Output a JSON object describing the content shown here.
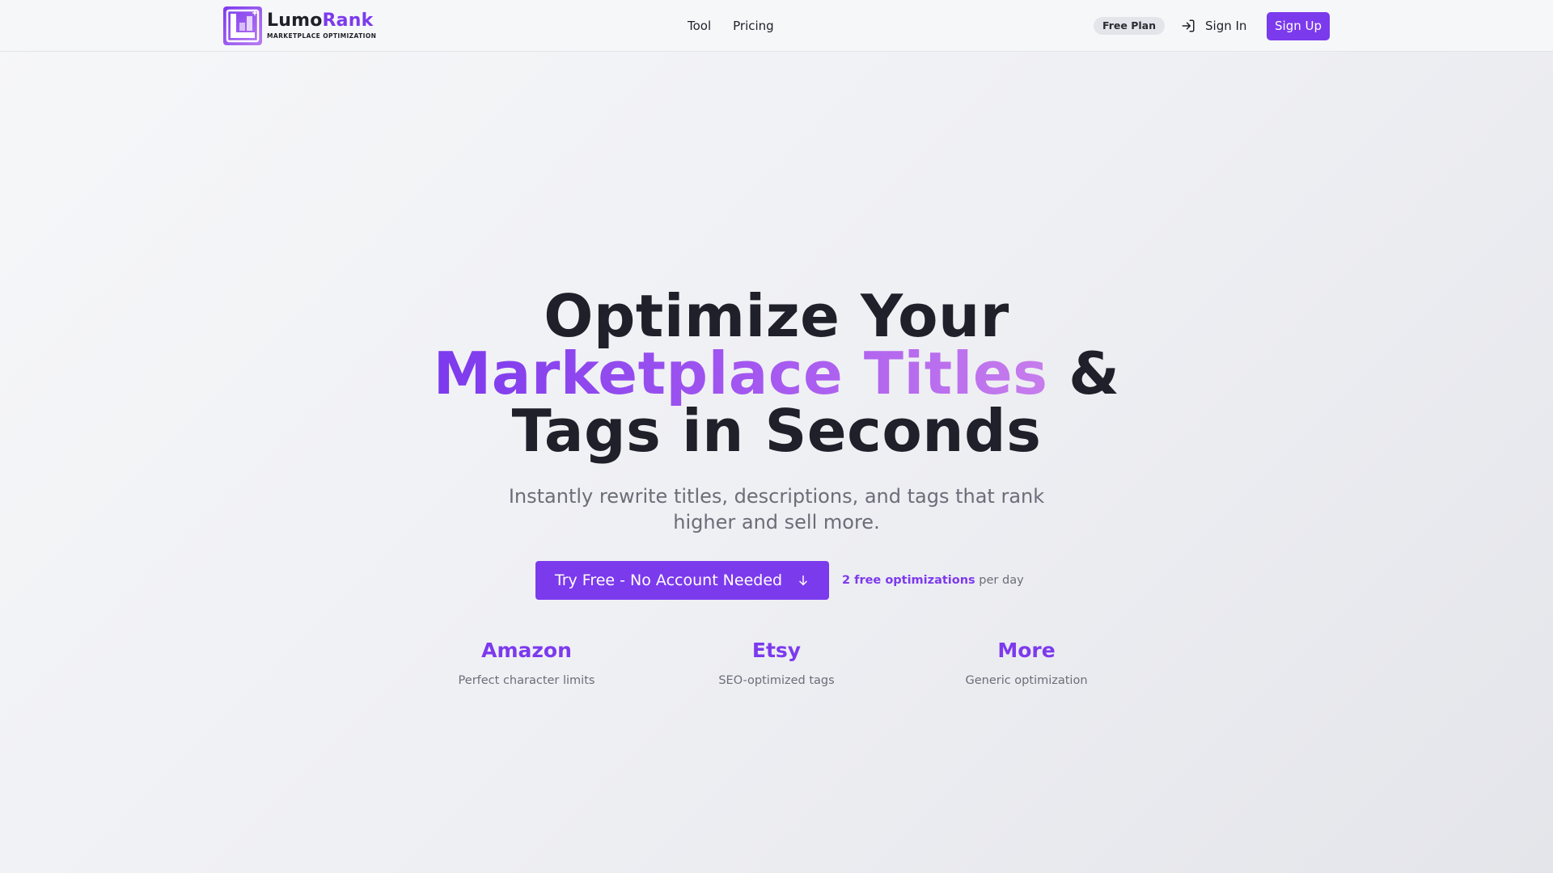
{
  "brand": {
    "name_part1": "Lumo",
    "name_part2": "Rank",
    "tagline": "MARKETPLACE OPTIMIZATION",
    "accent_color": "#7c3aed"
  },
  "nav": {
    "links": [
      "Tool",
      "Pricing"
    ],
    "plan_badge": "Free Plan",
    "signin_label": "Sign In",
    "signin_icon": "sign-in-icon",
    "signup_label": "Sign Up"
  },
  "hero": {
    "title_line1": "Optimize Your",
    "title_highlight": "Marketplace Titles",
    "title_amp": " &",
    "title_line3": "Tags in Seconds",
    "subtitle": "Instantly rewrite titles, descriptions, and tags that rank higher and sell more.",
    "cta_label": "Try Free - No Account Needed",
    "cta_icon": "arrow-down-icon",
    "note_bold": "2 free optimizations",
    "note_rest": " per day"
  },
  "features": [
    {
      "title": "Amazon",
      "desc": "Perfect character limits"
    },
    {
      "title": "Etsy",
      "desc": "SEO-optimized tags"
    },
    {
      "title": "More",
      "desc": "Generic optimization"
    }
  ]
}
